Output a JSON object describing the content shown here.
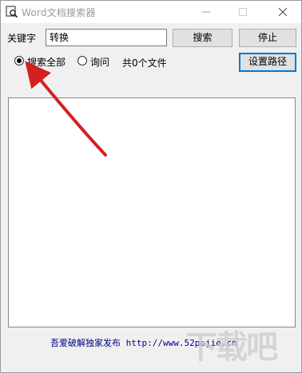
{
  "window": {
    "title": "Word文档搜索器"
  },
  "search": {
    "keyword_label": "关键字",
    "keyword_value": "转换",
    "search_button": "搜索",
    "stop_button": "停止",
    "set_path_button": "设置路径"
  },
  "options": {
    "search_all": {
      "label": "搜索全部",
      "checked": true
    },
    "query": {
      "label": "询问",
      "checked": false
    }
  },
  "status": {
    "file_count": "共0个文件"
  },
  "results": {
    "items": []
  },
  "footer": {
    "text": "吾爱破解独家发布 http://www.52pojie.cn"
  },
  "watermark": {
    "text": "下载吧"
  },
  "colors": {
    "annotation_arrow": "#d42020",
    "footer_text": "#00008b",
    "default_button_border": "#0078d7"
  }
}
